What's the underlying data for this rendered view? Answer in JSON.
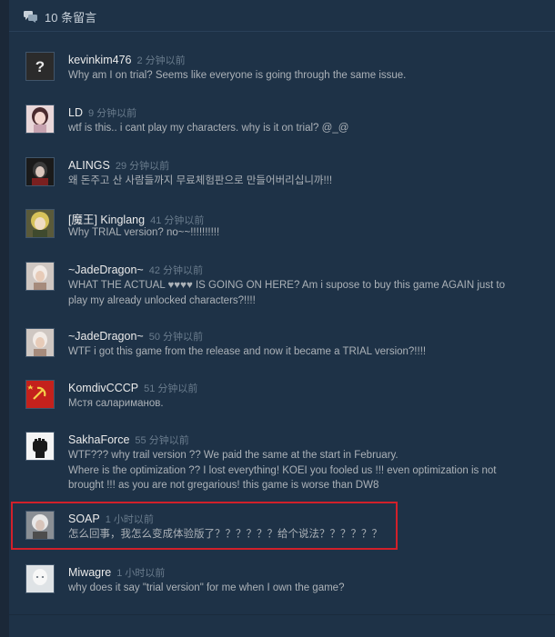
{
  "header": {
    "count_label": "10 条留言",
    "icon": "chat-bubbles-icon"
  },
  "highlight_color": "#d2202a",
  "comments": [
    {
      "author": "kevinkim476",
      "time": "2 分钟以前",
      "text": "Why am I on trial? Seems like everyone is going through the same issue.",
      "avatar": "question-mark-avatar"
    },
    {
      "author": "LD",
      "time": "9 分钟以前",
      "text": "wtf is this.. i cant play my characters. why is it on trial? @_@",
      "avatar": "anime-girl-avatar"
    },
    {
      "author": "ALINGS",
      "time": "29 分钟以前",
      "text": "왜 돈주고 산 사람들까지 무료체험판으로 만들어버리십니까!!!",
      "avatar": "dark-character-avatar"
    },
    {
      "author": "[魔王] Kinglang",
      "time": "41 分钟以前",
      "text": "Why TRIAL version? no~~!!!!!!!!!!",
      "avatar": "blonde-character-avatar"
    },
    {
      "author": "~JadeDragon~",
      "time": "42 分钟以前",
      "text": "WHAT THE ACTUAL ♥♥♥♥ IS GOING ON HERE? Am i supose to buy this game AGAIN just to play my already unlocked characters?!!!!",
      "avatar": "jade-avatar"
    },
    {
      "author": "~JadeDragon~",
      "time": "50 分钟以前",
      "text": "WTF i got this game from the release and now it became a TRIAL version?!!!!",
      "avatar": "jade-avatar"
    },
    {
      "author": "KomdivCCCP",
      "time": "51 分钟以前",
      "text": "Мстя салариманов.",
      "avatar": "red-flag-avatar"
    },
    {
      "author": "SakhaForce",
      "time": "55 分钟以前",
      "text": "WTF??? why trail version ?? We paid the same at the start in February.\nWhere is the optimization ?? I lost everything! KOEI you fooled us !!! even optimization is not brought !!! as you are not gregarious! this game is worse than DW8",
      "avatar": "fist-avatar"
    },
    {
      "author": "SOAP",
      "time": "1 小时以前",
      "text": "怎么回事，我怎么变成体验版了？？？？？？给个说法？？？？？？",
      "avatar": "white-hair-avatar"
    },
    {
      "author": "Miwagre",
      "time": "1 小时以前",
      "text": "why does it say \"trial version\" for me when I own the game?",
      "avatar": "pale-face-avatar"
    }
  ]
}
